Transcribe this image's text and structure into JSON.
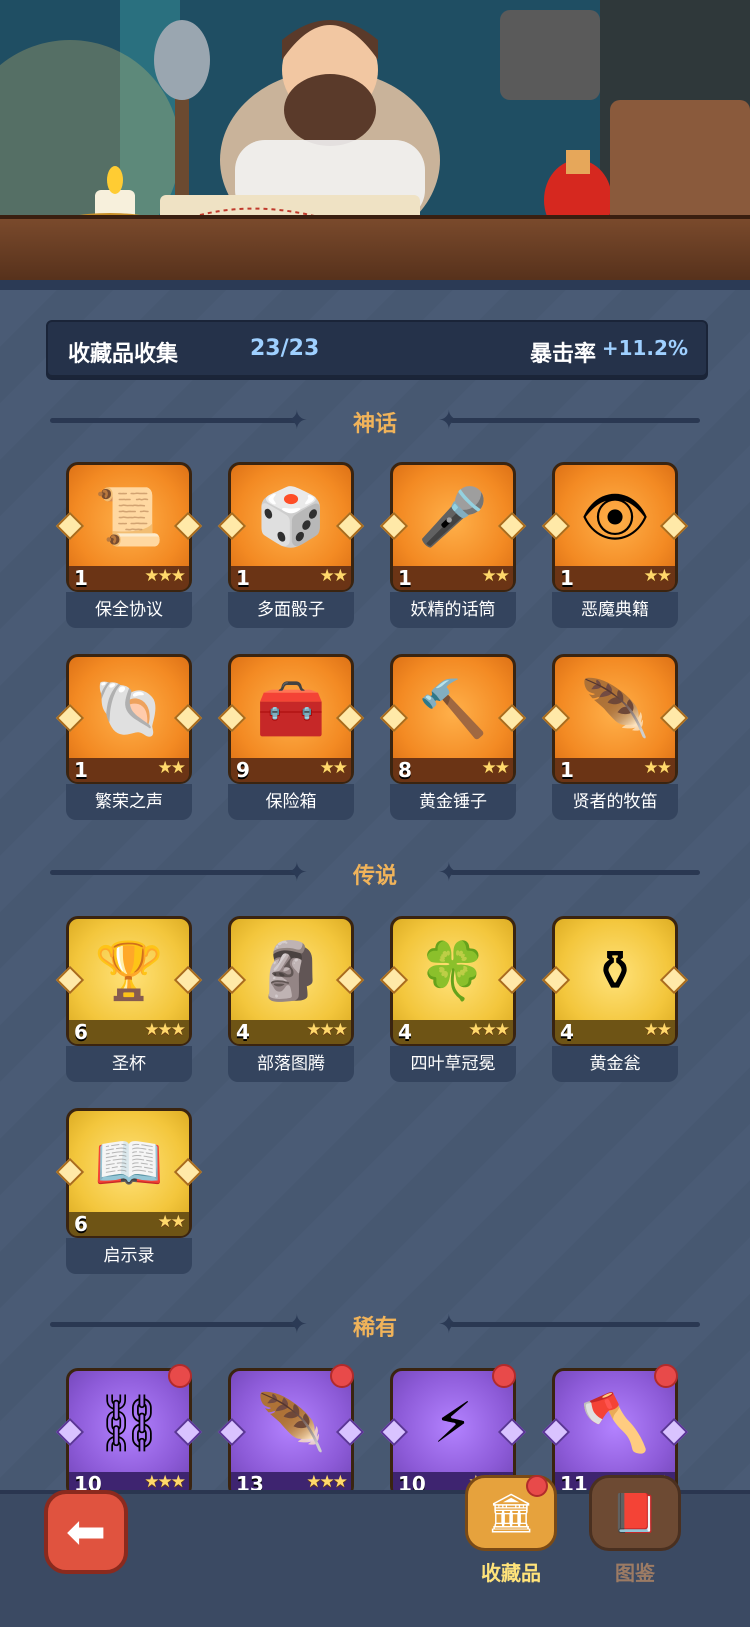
{
  "header": {
    "label": "收藏品收集",
    "count": "23/23",
    "crit_label": "暴击率",
    "crit_value": "+11.2%"
  },
  "sections": {
    "mythic": "神话",
    "legend": "传说",
    "rare": "稀有"
  },
  "cards": [
    {
      "name": "保全协议",
      "level": "1",
      "stars": "★★★",
      "icon": "📜"
    },
    {
      "name": "多面骰子",
      "level": "1",
      "stars": "★★",
      "icon": "🎲"
    },
    {
      "name": "妖精的话筒",
      "level": "1",
      "stars": "★★",
      "icon": "🎤"
    },
    {
      "name": "恶魔典籍",
      "level": "1",
      "stars": "★★",
      "icon": "👁"
    },
    {
      "name": "繁荣之声",
      "level": "1",
      "stars": "★★",
      "icon": "🐚"
    },
    {
      "name": "保险箱",
      "level": "9",
      "stars": "★★",
      "icon": "🧰"
    },
    {
      "name": "黄金锤子",
      "level": "8",
      "stars": "★★",
      "icon": "🔨"
    },
    {
      "name": "贤者的牧笛",
      "level": "1",
      "stars": "★★",
      "icon": "🪶"
    },
    {
      "name": "圣杯",
      "level": "6",
      "stars": "★★★",
      "icon": "🏆"
    },
    {
      "name": "部落图腾",
      "level": "4",
      "stars": "★★★",
      "icon": "🗿"
    },
    {
      "name": "四叶草冠冕",
      "level": "4",
      "stars": "★★★",
      "icon": "🍀"
    },
    {
      "name": "黄金瓮",
      "level": "4",
      "stars": "★★",
      "icon": "⚱"
    },
    {
      "name": "启示录",
      "level": "6",
      "stars": "★★",
      "icon": "📖"
    },
    {
      "name": "",
      "level": "10",
      "stars": "★★★",
      "icon": "⛓"
    },
    {
      "name": "",
      "level": "13",
      "stars": "★★★",
      "icon": "🪶"
    },
    {
      "name": "",
      "level": "10",
      "stars": "★★★",
      "icon": "⚡"
    },
    {
      "name": "",
      "level": "11",
      "stars": "★★★",
      "icon": "🪓"
    }
  ],
  "nav": {
    "back_icon": "⬅",
    "collect_label": "收藏品",
    "atlas_label": "图鉴",
    "collect_icon": "🏛",
    "atlas_icon": "📕"
  }
}
